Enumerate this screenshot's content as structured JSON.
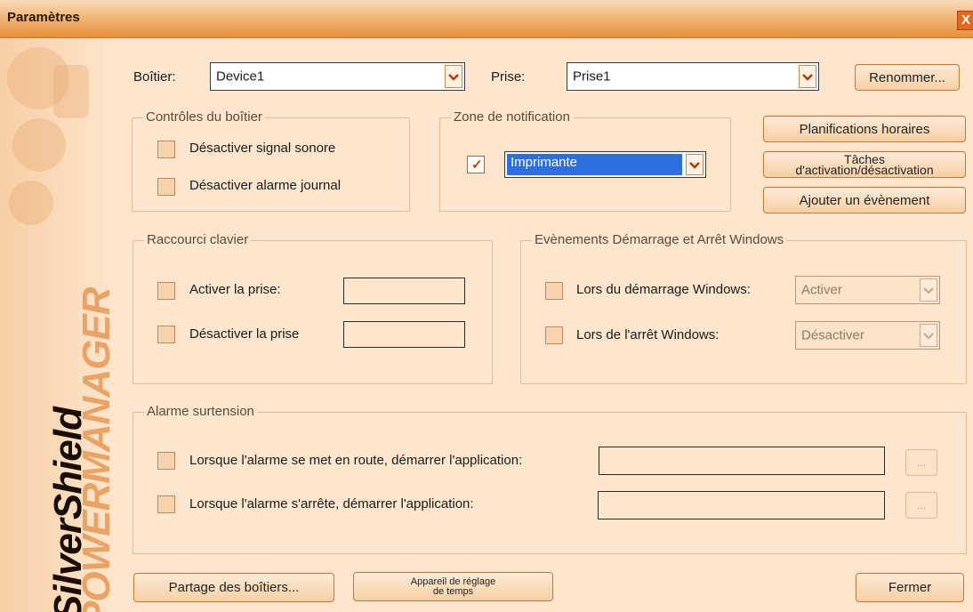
{
  "window": {
    "title": "Paramètres",
    "close_glyph": "X"
  },
  "top_row": {
    "device_label": "Boîtier:",
    "device_value": "Device1",
    "outlet_label": "Prise:",
    "outlet_value": "Prise1",
    "rename_button": "Renommer..."
  },
  "device_controls": {
    "legend": "Contrôles du boîtier",
    "disable_sound": "Désactiver signal sonore",
    "disable_log_alarm": "Désactiver alarme journal"
  },
  "notification": {
    "legend": "Zone de notification",
    "value": "Imprimante"
  },
  "side_buttons": {
    "schedules": "Planifications horaires",
    "tasks_line1": "Tâches",
    "tasks_line2": "d'activation/désactivation",
    "add_event": "Ajouter un évènement"
  },
  "hotkeys": {
    "legend": "Raccourci clavier",
    "activate_outlet": "Activer la prise:",
    "deactivate_outlet": "Désactiver la prise"
  },
  "windows_events": {
    "legend": "Evènements Démarrage et Arrêt Windows",
    "on_startup": "Lors du démarrage Windows:",
    "on_startup_value": "Activer",
    "on_shutdown": "Lors de l'arrêt Windows:",
    "on_shutdown_value": "Désactiver"
  },
  "surge_alarm": {
    "legend": "Alarme surtension",
    "on_alarm_start": "Lorsque l'alarme se met en route, démarrer l'application:",
    "on_alarm_stop": "Lorsque l'alarme s'arrête, démarrer l'application:",
    "browse": "..."
  },
  "bottom": {
    "share_devices": "Partage des boîtiers...",
    "timer_line1": "Appareil de réglage",
    "timer_line2": "de temps",
    "close": "Fermer"
  },
  "branding": {
    "line1": "SilverShield",
    "line2": "POWERMANAGER"
  },
  "colors": {
    "accent": "#e58f3c",
    "background": "#fde6cd",
    "check": "#d23c00",
    "selection": "#2d6fe0"
  },
  "icons": {
    "dropdown": "chevron-down-icon",
    "check": "checkmark-icon",
    "close": "close-icon"
  }
}
